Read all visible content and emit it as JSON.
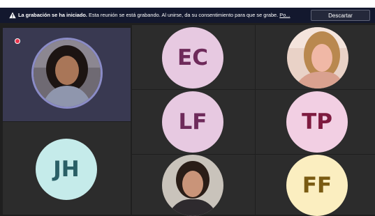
{
  "colors": {
    "banner_bg": "#13182e",
    "tile_bg": "#2c2c2c",
    "self_tile_bg": "#393951",
    "speaking_ring": "#8b8cc7",
    "recording_dot": "#e8344d"
  },
  "banner": {
    "icon": "warning-icon",
    "title": "La grabación se ha iniciado.",
    "message": "Esta reunión se está grabando. Al unirse, da su consentimiento para que se grabe.",
    "link_text": "Po...",
    "dismiss_label": "Descartar"
  },
  "participants": [
    {
      "type": "photo",
      "speaking": true
    },
    {
      "type": "initials",
      "initials": "EC",
      "color": "#e7c9e1",
      "text_color": "#6e2a5a"
    },
    {
      "type": "photo"
    },
    {
      "type": "initials",
      "initials": "LF",
      "color": "#e7c9e1",
      "text_color": "#6e2a5a"
    },
    {
      "type": "initials",
      "initials": "TP",
      "color": "#f2cfe3",
      "text_color": "#7d1a3f"
    },
    {
      "type": "initials",
      "initials": "JH",
      "color": "#c5ebea",
      "text_color": "#2a5f66"
    },
    {
      "type": "photo"
    },
    {
      "type": "initials",
      "initials": "FF",
      "color": "#fbeec0",
      "text_color": "#7a5b12"
    }
  ]
}
